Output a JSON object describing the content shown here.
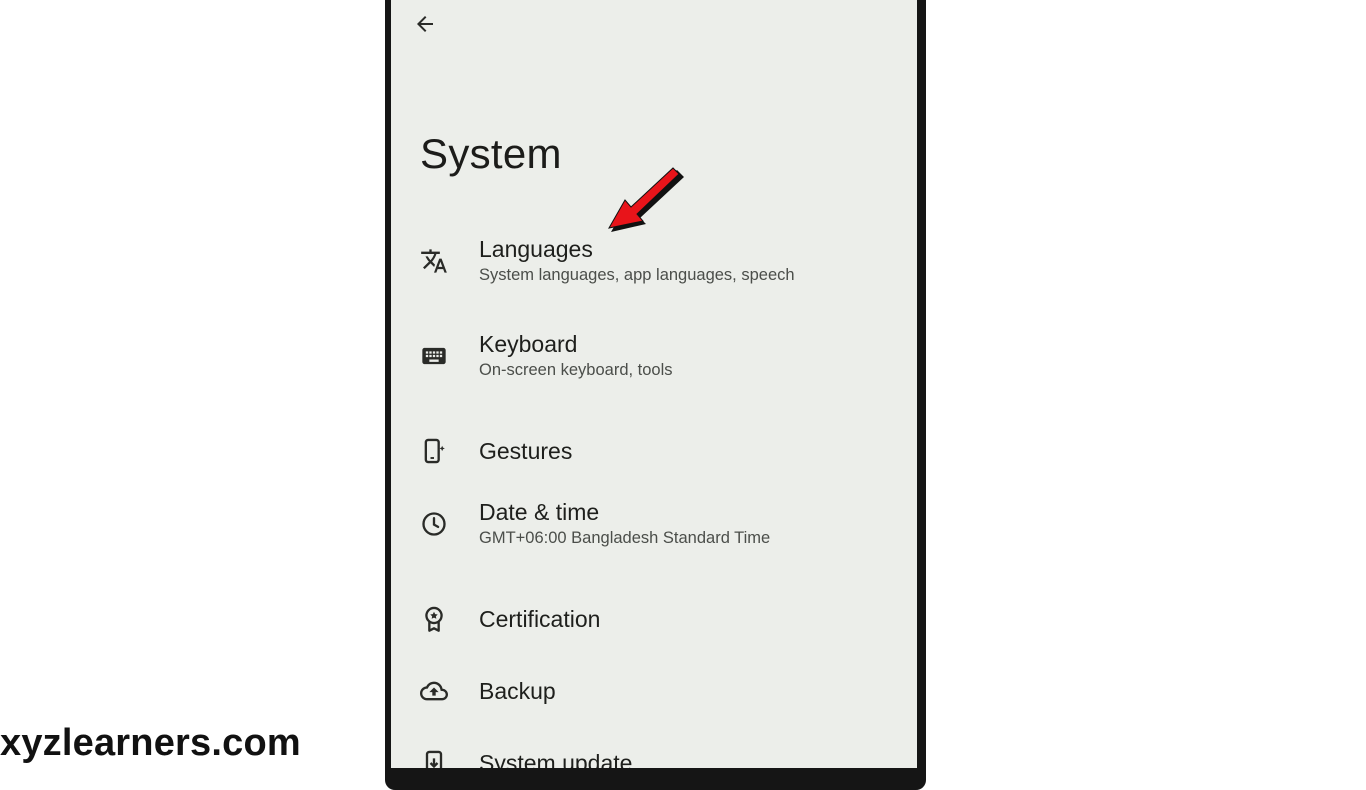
{
  "header": {
    "back_icon": "arrow-back-icon"
  },
  "page": {
    "title": "System"
  },
  "settings_items": [
    {
      "label": "Languages",
      "subtitle": "System languages, app languages, speech",
      "icon": "translate-icon"
    },
    {
      "label": "Keyboard",
      "subtitle": "On-screen keyboard, tools",
      "icon": "keyboard-icon"
    },
    {
      "label": "Gestures",
      "icon": "gesture-phone-icon"
    },
    {
      "label": "Date & time",
      "subtitle": "GMT+06:00 Bangladesh Standard Time",
      "icon": "clock-icon"
    },
    {
      "label": "Certification",
      "icon": "certification-badge-icon"
    },
    {
      "label": "Backup",
      "icon": "cloud-backup-icon"
    },
    {
      "label": "System update",
      "icon": "system-update-icon"
    }
  ],
  "annotation": {
    "icon": "red-arrow-icon",
    "color": "#e8141a"
  },
  "watermark": "xyzlearners.com",
  "colors": {
    "screen_bg": "#eceeea",
    "text_primary": "#1e1f1c",
    "text_secondary": "#4b4e4a"
  }
}
